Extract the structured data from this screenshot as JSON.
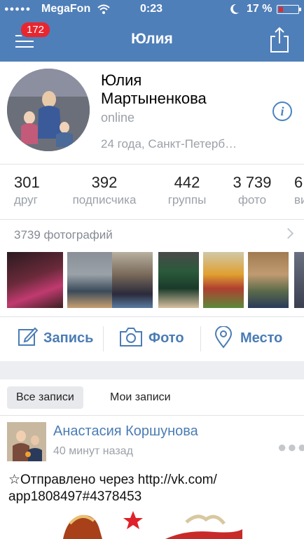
{
  "status_bar": {
    "signal": "●●●●●",
    "carrier": "MegaFon",
    "time": "0:23",
    "battery": "17 %"
  },
  "nav": {
    "title": "Юлия",
    "badge_count": "172"
  },
  "profile": {
    "name_line1": "Юлия",
    "name_line2": "Мартыненкова",
    "status": "online",
    "info": "24 года, Санкт-Петерб…"
  },
  "counters": [
    {
      "number": "301",
      "label": "друг"
    },
    {
      "number": "392",
      "label": "подписчика"
    },
    {
      "number": "442",
      "label": "группы"
    },
    {
      "number": "3 739",
      "label": "фото"
    },
    {
      "number": "6",
      "label": "ви"
    }
  ],
  "photos": {
    "header": "3739 фотографий"
  },
  "actions": {
    "post_label": "Запись",
    "photo_label": "Фото",
    "place_label": "Место"
  },
  "tabs": {
    "all": "Все записи",
    "mine": "Мои записи"
  },
  "post": {
    "author": "Анастасия Коршунова",
    "time": "40 минут назад",
    "text_line1": "☆Отправлено через http://vk.com/",
    "text_line2": "app1808497#4378453"
  },
  "colors": {
    "nav_blue": "#4f7fb9",
    "link_blue": "#4a7cb5",
    "badge_red": "#e8262f"
  }
}
